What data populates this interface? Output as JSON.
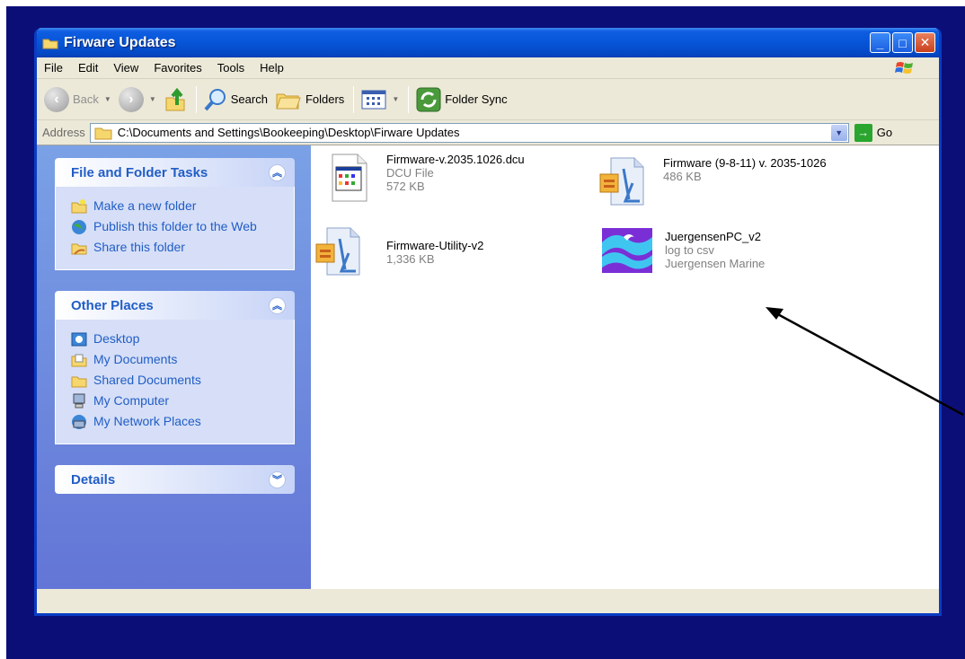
{
  "window": {
    "title": "Firware Updates",
    "caption_min": "_",
    "caption_max": "□",
    "caption_close": "✕"
  },
  "menu": [
    "File",
    "Edit",
    "View",
    "Favorites",
    "Tools",
    "Help"
  ],
  "toolbar": {
    "back": "Back",
    "search": "Search",
    "folders": "Folders",
    "folder_sync": "Folder Sync"
  },
  "address": {
    "label": "Address",
    "path": "C:\\Documents and Settings\\Bookeeping\\Desktop\\Firware Updates",
    "go": "Go"
  },
  "sidebar": {
    "file_tasks": {
      "title": "File and Folder Tasks",
      "items": [
        "Make a new folder",
        "Publish this folder to the Web",
        "Share this folder"
      ]
    },
    "other_places": {
      "title": "Other Places",
      "items": [
        "Desktop",
        "My Documents",
        "Shared Documents",
        "My Computer",
        "My Network Places"
      ]
    },
    "details": {
      "title": "Details"
    }
  },
  "files": [
    {
      "name": "Firmware-v.2035.1026.dcu",
      "line2": "DCU File",
      "line3": "572 KB",
      "icon": "dcu-file-icon"
    },
    {
      "name": "Firmware (9-8-11) v. 2035-1026",
      "line2": "486 KB",
      "line3": "",
      "icon": "zip-file-icon"
    },
    {
      "name": "Firmware-Utility-v2",
      "line2": "1,336 KB",
      "line3": "",
      "icon": "zip-file-icon"
    },
    {
      "name": "JuergensenPC_v2",
      "line2": "log to csv",
      "line3": "Juergensen Marine",
      "icon": "wave-app-icon"
    }
  ],
  "colors": {
    "title_blue": "#0655d8",
    "task_link": "#215dc6",
    "backdrop": "#0c0e78"
  }
}
